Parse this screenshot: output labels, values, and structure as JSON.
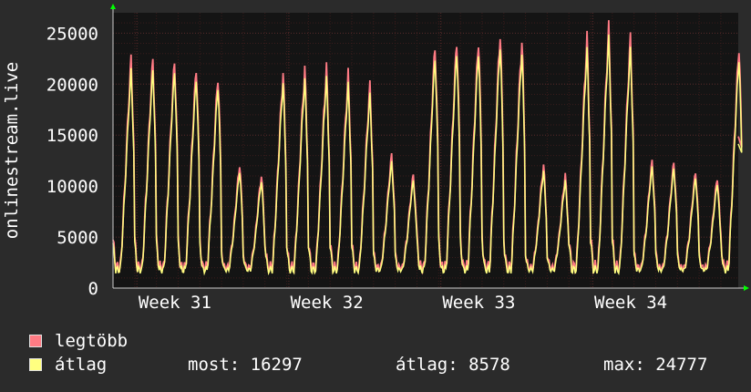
{
  "chart_data": {
    "type": "area",
    "ylabel": "onlinestream.live",
    "yticks": [
      0,
      5000,
      10000,
      15000,
      20000,
      25000
    ],
    "ylim": [
      0,
      27000
    ],
    "x_ticks": [
      "Week 31",
      "Week 32",
      "Week 33",
      "Week 34"
    ],
    "days": 29,
    "daily_peak_legtobb": [
      22800,
      22700,
      22600,
      21900,
      21000,
      12300,
      11200,
      21300,
      21700,
      21800,
      21200,
      20100,
      13200,
      11300,
      24000,
      24600,
      24600,
      25300,
      24600,
      12200,
      11200,
      24800,
      25800,
      24800,
      12600,
      12500,
      11600,
      11000,
      24000
    ],
    "daily_peak_atlag": [
      21600,
      21600,
      21500,
      20800,
      20000,
      11600,
      10600,
      20300,
      20600,
      20700,
      20100,
      19100,
      12500,
      10700,
      22800,
      23400,
      23400,
      24000,
      23300,
      11600,
      10600,
      23500,
      24700,
      23600,
      12000,
      11900,
      11000,
      10400,
      22800
    ],
    "series": [
      {
        "name": "legtöbb",
        "color": "#ff7b84"
      },
      {
        "name": "átlag",
        "color": "#ffff80"
      }
    ]
  },
  "legend": {
    "max_label": "legtöbb",
    "avg_label": "átlag"
  },
  "stats": {
    "most": "most: 16297",
    "atlag": "átlag: 8578",
    "max": "max: 24777"
  },
  "colors": {
    "background": "#2b2b2b",
    "plot_bg": "#141414",
    "grid": "#5a2a2a",
    "axis_text": "#ffffff",
    "axis_arrow": "#00ff00"
  }
}
